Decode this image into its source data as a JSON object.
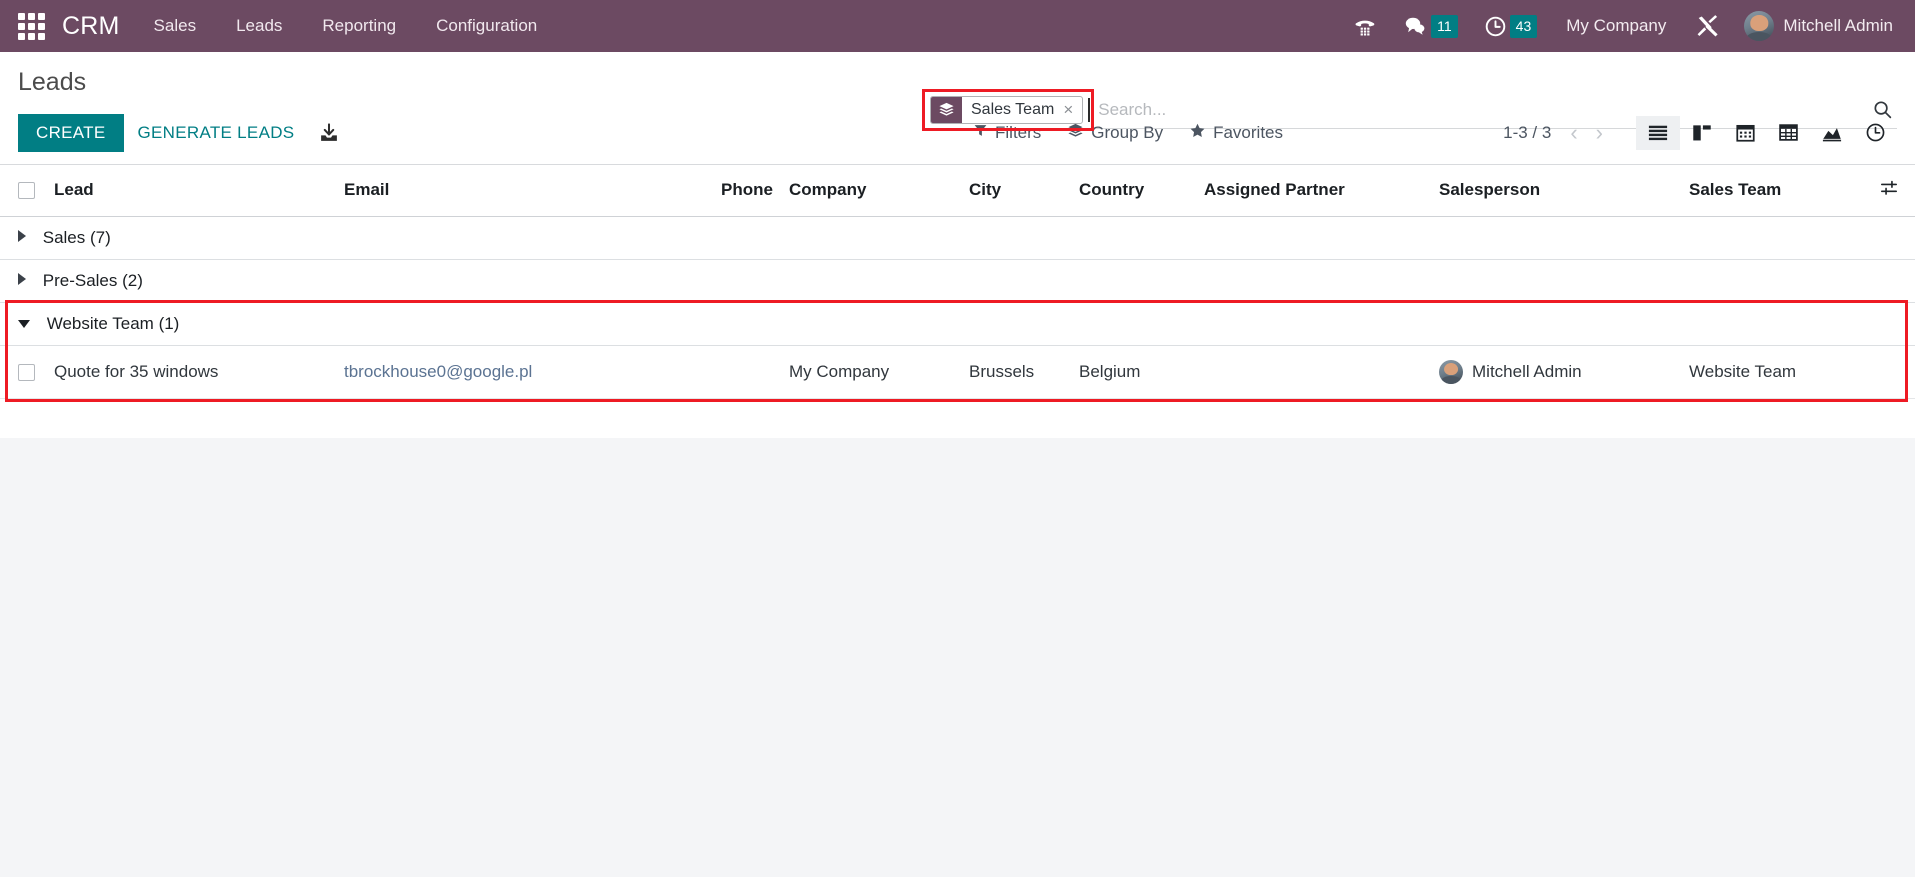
{
  "navbar": {
    "apps_icon": "apps-grid-icon",
    "brand": "CRM",
    "menu": [
      {
        "label": "Sales"
      },
      {
        "label": "Leads"
      },
      {
        "label": "Reporting"
      },
      {
        "label": "Configuration"
      }
    ],
    "phone_icon": "phone-dialpad-icon",
    "messages_icon": "chat-bubble-icon",
    "messages_count": "11",
    "activities_icon": "clock-icon",
    "activities_count": "43",
    "company": "My Company",
    "tools_icon": "tools-icon",
    "avatar_icon": "avatar",
    "user": "Mitchell Admin",
    "accent_purple": "#6c4a62",
    "accent_teal": "#017e84"
  },
  "control_panel": {
    "title": "Leads",
    "create_label": "CREATE",
    "generate_leads_label": "GENERATE LEADS",
    "import_icon": "import-download-icon",
    "filters_label": "Filters",
    "filters_icon": "funnel-icon",
    "groupby_label": "Group By",
    "groupby_icon": "layers-icon",
    "favorites_label": "Favorites",
    "favorites_icon": "star-icon",
    "pager": "1-3 / 3",
    "pager_prev_icon": "chevron-left-icon",
    "pager_next_icon": "chevron-right-icon",
    "views": [
      {
        "name": "list",
        "icon": "list-view-icon",
        "active": true
      },
      {
        "name": "kanban",
        "icon": "kanban-view-icon",
        "active": false
      },
      {
        "name": "calendar",
        "icon": "calendar-view-icon",
        "active": false
      },
      {
        "name": "pivot",
        "icon": "pivot-view-icon",
        "active": false
      },
      {
        "name": "graph",
        "icon": "graph-view-icon",
        "active": false
      },
      {
        "name": "activity",
        "icon": "activity-clock-view-icon",
        "active": false
      }
    ]
  },
  "search": {
    "facet_icon": "layers-icon",
    "facet_label": "Sales Team",
    "facet_remove_icon": "close-x-icon",
    "placeholder": "Search...",
    "value": "",
    "search_icon": "search-icon"
  },
  "table": {
    "columns": [
      "Lead",
      "Email",
      "Phone",
      "Company",
      "City",
      "Country",
      "Assigned Partner",
      "Salesperson",
      "Sales Team"
    ],
    "options_icon": "column-options-icon",
    "select_all_icon": "checkbox",
    "groups": [
      {
        "label": "Sales",
        "count": "(7)",
        "expanded": false
      },
      {
        "label": "Pre-Sales",
        "count": "(2)",
        "expanded": false
      },
      {
        "label": "Website Team",
        "count": "(1)",
        "expanded": true
      }
    ],
    "rows": [
      {
        "lead": "Quote for 35 windows",
        "email": "tbrockhouse0@google.pl",
        "phone": "",
        "company": "My Company",
        "city": "Brussels",
        "country": "Belgium",
        "assigned_partner": "",
        "salesperson": "Mitchell Admin",
        "sales_team": "Website Team"
      }
    ]
  },
  "annotations": {
    "color": "#ee1b24",
    "boxes": [
      {
        "name": "search-facet-highlight"
      },
      {
        "name": "website-team-group-highlight"
      }
    ]
  }
}
